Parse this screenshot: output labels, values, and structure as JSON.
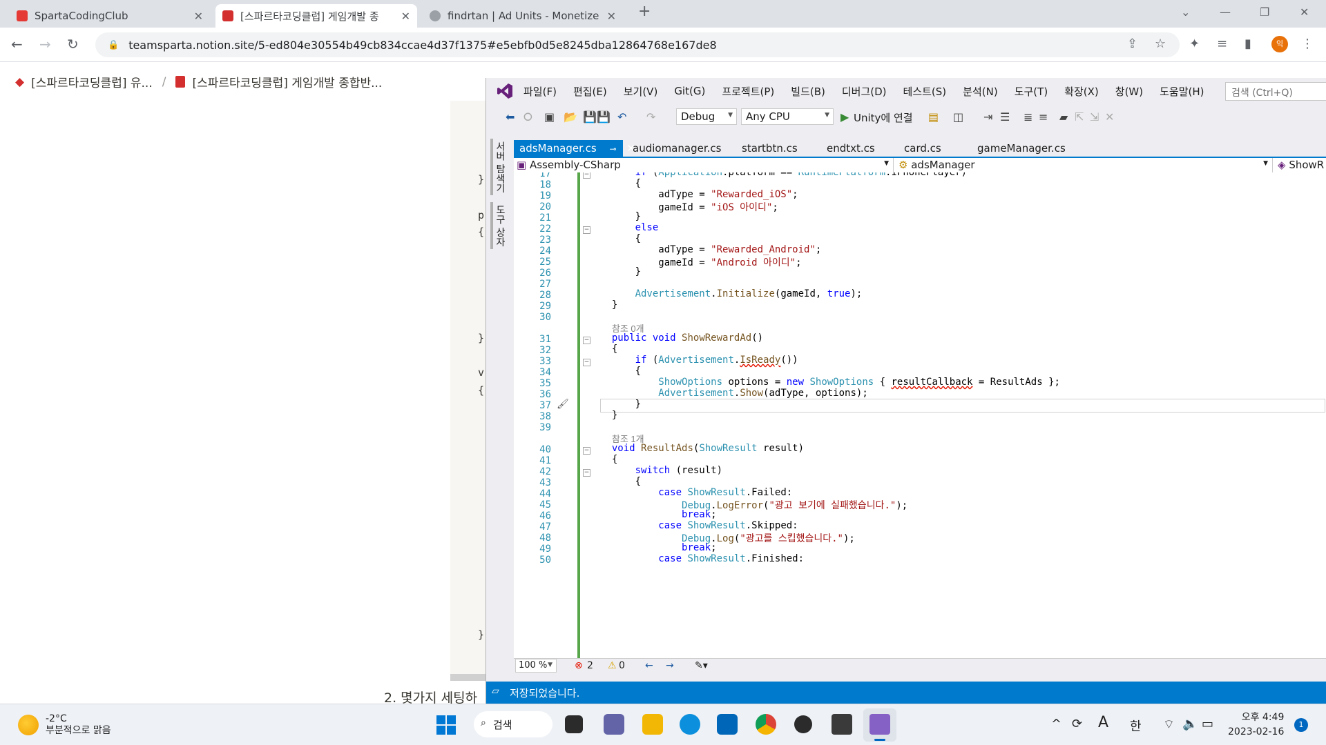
{
  "browser": {
    "tabs": [
      {
        "title": "SpartaCodingClub",
        "color": "#e53935"
      },
      {
        "title": "[스파르타코딩클럽] 게임개발 종",
        "color": "#d32f2f"
      },
      {
        "title": "findrtan | Ad Units - Monetize",
        "color": "#5f6368"
      }
    ],
    "url": "teamsparta.notion.site/5-ed804e30554b49cb834ccae4d37f1375#e5ebfb0d5e8245dba12864768e167de8",
    "profile_initial": "익"
  },
  "notion": {
    "breadcrumb": [
      "[스파르타코딩클럽] 유...",
      "[스파르타코딩클럽] 게임개발 종합반..."
    ],
    "breadcrumb_sep": "/",
    "code_fragments": [
      "}",
      "p",
      "{",
      "}",
      "v",
      "{",
      "}"
    ],
    "list_item": "2.  몇가지 세팅하"
  },
  "vs": {
    "menu": [
      "파일(F)",
      "편집(E)",
      "보기(V)",
      "Git(G)",
      "프로젝트(P)",
      "빌드(B)",
      "디버그(D)",
      "테스트(S)",
      "분석(N)",
      "도구(T)",
      "확장(X)",
      "창(W)",
      "도움말(H)"
    ],
    "search_placeholder": "검색 (Ctrl+Q)",
    "config": "Debug",
    "platform": "Any CPU",
    "run_label": "Unity에 연결",
    "side_tabs": [
      "서버 탐색기",
      "도구 상자"
    ],
    "doc_tabs": [
      "adsManager.cs",
      "audiomanager.cs",
      "startbtn.cs",
      "endtxt.cs",
      "card.cs",
      "gameManager.cs"
    ],
    "nav_project": "Assembly-CSharp",
    "nav_class": "adsManager",
    "nav_member": "ShowR",
    "line_numbers": [
      "17",
      "18",
      "19",
      "20",
      "21",
      "22",
      "23",
      "24",
      "25",
      "26",
      "27",
      "28",
      "29",
      "30",
      "",
      "31",
      "32",
      "33",
      "34",
      "35",
      "36",
      "37",
      "38",
      "39",
      "",
      "40",
      "41",
      "42",
      "43",
      "44",
      "45",
      "46",
      "47",
      "48",
      "49",
      "50"
    ],
    "refs": [
      "참조 0개",
      "참조 1개"
    ],
    "zoom": "100 %",
    "errors": "2",
    "warnings": "0",
    "status": "저장되었습니다."
  },
  "taskbar": {
    "temp": "-2°C",
    "weather": "부분적으로 맑음",
    "search": "검색",
    "ime_a": "A",
    "ime_lang": "한",
    "time": "오후 4:49",
    "date": "2023-02-16",
    "notifications": "1"
  }
}
